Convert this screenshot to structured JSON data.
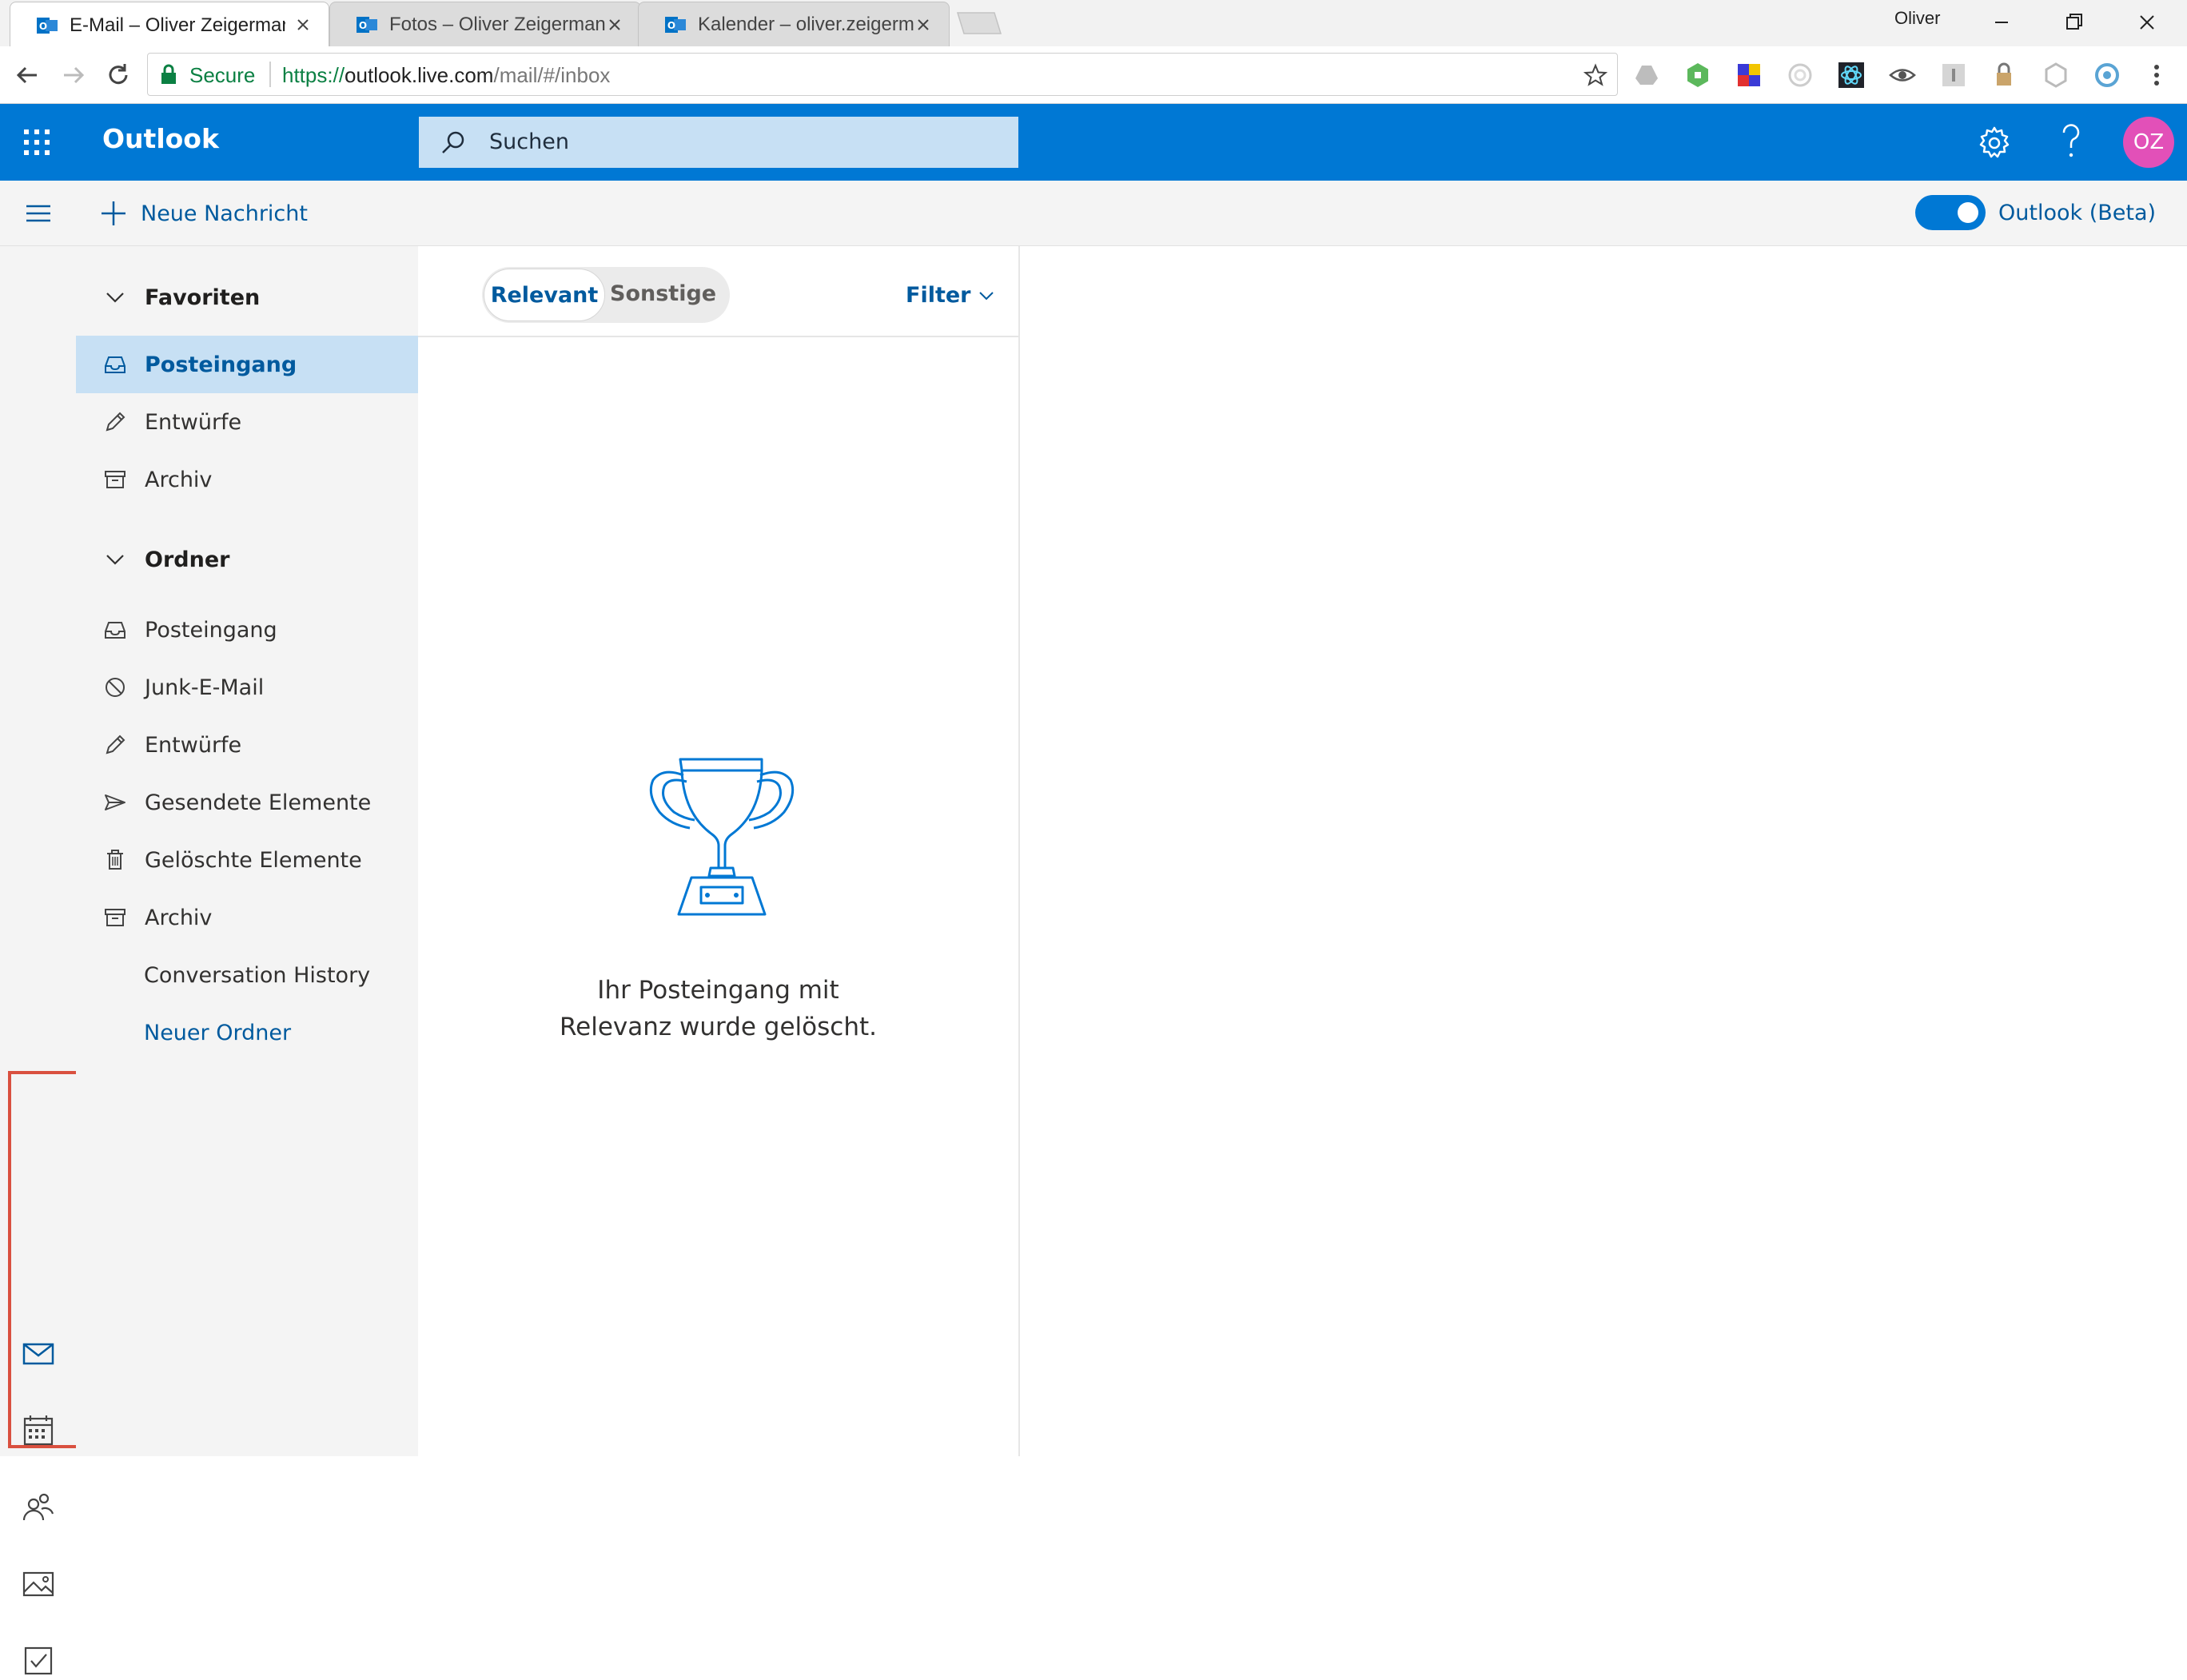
{
  "browser": {
    "tabs": [
      {
        "title": "E-Mail – Oliver Zeigerman",
        "active": true
      },
      {
        "title": "Fotos – Oliver Zeigerman",
        "active": false
      },
      {
        "title": "Kalender – oliver.zeigerman",
        "active": false
      }
    ],
    "profile_name": "Oliver",
    "secure_label": "Secure",
    "url": {
      "scheme": "https://",
      "host": "outlook.live.com",
      "path": "/mail/#/inbox"
    }
  },
  "header": {
    "app_title": "Outlook",
    "search_placeholder": "Suchen",
    "avatar_initials": "OZ",
    "accent_color": "#0078d4",
    "avatar_color": "#e250b8"
  },
  "commandbar": {
    "new_message": "Neue Nachricht",
    "beta_toggle_label": "Outlook (Beta)",
    "beta_toggle_on": true
  },
  "rail": {
    "items": [
      {
        "icon": "mail-icon",
        "label": "Mail"
      },
      {
        "icon": "calendar-icon",
        "label": "Kalender"
      },
      {
        "icon": "people-icon",
        "label": "Personen"
      },
      {
        "icon": "photos-icon",
        "label": "Fotos"
      },
      {
        "icon": "tasks-icon",
        "label": "Aufgaben"
      }
    ]
  },
  "folders": {
    "favorites_heading": "Favoriten",
    "favorites": [
      {
        "label": "Posteingang",
        "icon": "inbox-icon",
        "selected": true
      },
      {
        "label": "Entwürfe",
        "icon": "pencil-icon"
      },
      {
        "label": "Archiv",
        "icon": "archive-icon"
      }
    ],
    "folders_heading": "Ordner",
    "folders": [
      {
        "label": "Posteingang",
        "icon": "inbox-icon"
      },
      {
        "label": "Junk-E-Mail",
        "icon": "blocked-icon"
      },
      {
        "label": "Entwürfe",
        "icon": "pencil-icon"
      },
      {
        "label": "Gesendete Elemente",
        "icon": "send-icon"
      },
      {
        "label": "Gelöschte Elemente",
        "icon": "trash-icon"
      },
      {
        "label": "Archiv",
        "icon": "archive-icon"
      },
      {
        "label": "Conversation History",
        "icon": ""
      }
    ],
    "new_folder": "Neuer Ordner"
  },
  "messagelist": {
    "pivot_relevant": "Relevant",
    "pivot_other": "Sonstige",
    "filter_label": "Filter",
    "empty_line1": "Ihr Posteingang mit",
    "empty_line2": "Relevanz wurde gelöscht."
  }
}
